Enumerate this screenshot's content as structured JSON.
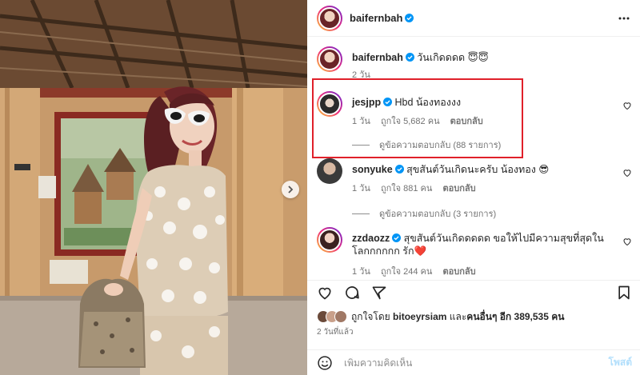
{
  "post": {
    "author": "baifernbah",
    "verified_icon": "verified-badge-icon",
    "more_icon": "more-options-icon",
    "carousel_icon": "chevron-right-icon"
  },
  "caption": {
    "username": "baifernbah",
    "text": "วันเกิดดดด 😇😇",
    "time": "2 วัน"
  },
  "comments": [
    {
      "username": "jesjpp",
      "text": "Hbd น้องทองงง",
      "time": "1 วัน",
      "likes": "ถูกใจ 5,682 คน",
      "reply_label": "ตอบกลับ",
      "view_replies": "ดูข้อความตอบกลับ (88 รายการ)"
    },
    {
      "username": "sonyuke",
      "text": "สุขสันต์วันเกิดนะครับ น้องทอง 😎",
      "time": "1 วัน",
      "likes": "ถูกใจ 881 คน",
      "reply_label": "ตอบกลับ",
      "view_replies": "ดูข้อความตอบกลับ (3 รายการ)"
    },
    {
      "username": "zzdaozz",
      "text": "สุขสันต์วันเกิดดดดด ขอให้ไปมีความสุขที่สุดในโลกกกกกก รัก❤️",
      "time": "1 วัน",
      "likes": "ถูกใจ 244 คน",
      "reply_label": "ตอบกลับ"
    }
  ],
  "actions": {
    "like_icon": "heart-icon",
    "comment_icon": "comment-icon",
    "share_icon": "share-icon",
    "save_icon": "bookmark-icon"
  },
  "likes": {
    "prefix": "ถูกใจโดย",
    "user": "bitoeyrsiam",
    "joiner": "และ",
    "others": "คนอื่นๆ อีก 389,535 คน"
  },
  "time_ago": "2 วันที่แล้ว",
  "add_comment": {
    "placeholder": "เพิ่มความคิดเห็น",
    "post_label": "โพสต์",
    "emoji_icon": "emoji-icon"
  },
  "colors": {
    "highlight": "#e0202a",
    "verified": "#0095f6",
    "post_disabled": "#b2dffc"
  }
}
